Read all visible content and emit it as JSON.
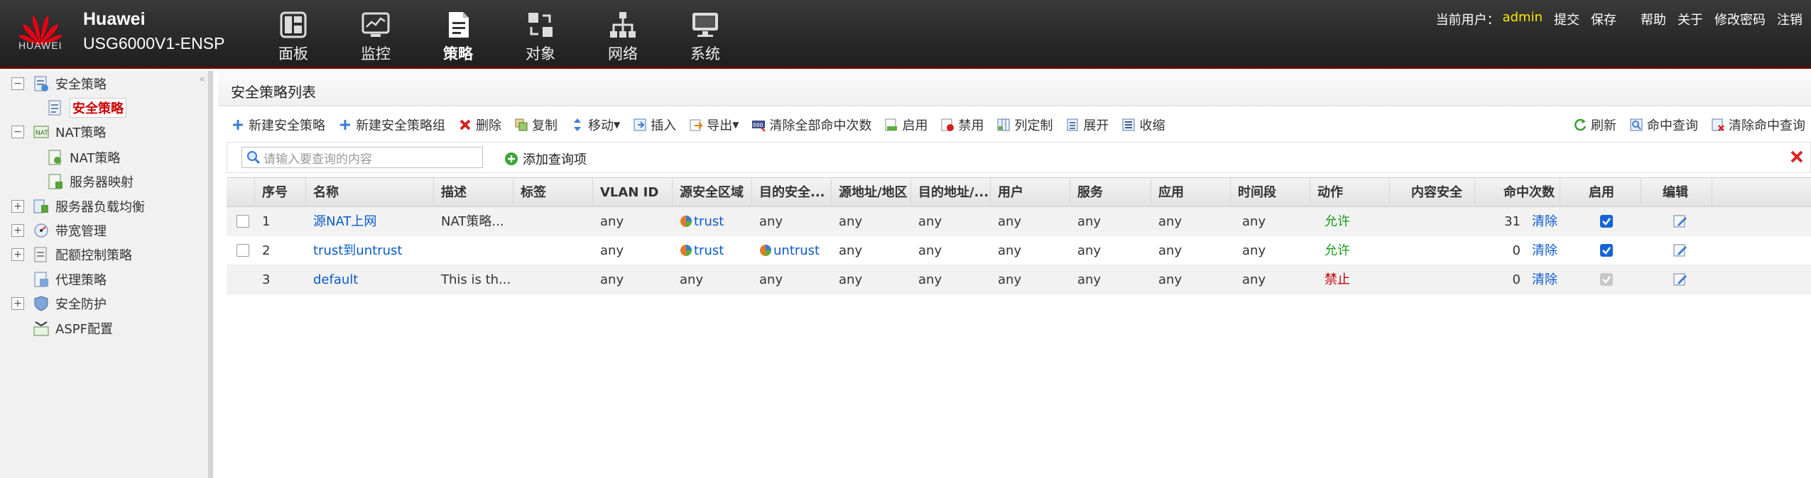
{
  "header": {
    "logo_text": "HUAWEI",
    "brand_line1": "Huawei",
    "brand_line2": "USG6000V1-ENSP",
    "nav": [
      {
        "label": "面板",
        "icon": "dashboard-icon"
      },
      {
        "label": "监控",
        "icon": "monitor-icon"
      },
      {
        "label": "策略",
        "icon": "policy-icon",
        "active": true
      },
      {
        "label": "对象",
        "icon": "object-icon"
      },
      {
        "label": "网络",
        "icon": "network-icon"
      },
      {
        "label": "系统",
        "icon": "system-icon"
      }
    ],
    "current_user_label": "当前用户：",
    "current_user": "admin",
    "actions": [
      "提交",
      "保存",
      "帮助",
      "关于",
      "修改密码",
      "注销"
    ]
  },
  "sidebar": {
    "collapse_glyph": "«",
    "items": [
      {
        "label": "安全策略",
        "level": 0,
        "expander": "−"
      },
      {
        "label": "安全策略",
        "level": 1,
        "selected": true
      },
      {
        "label": "NAT策略",
        "level": 0,
        "expander": "−"
      },
      {
        "label": "NAT策略",
        "level": 1
      },
      {
        "label": "服务器映射",
        "level": 1
      },
      {
        "label": "服务器负载均衡",
        "level": 0,
        "expander": "+"
      },
      {
        "label": "带宽管理",
        "level": 0,
        "expander": "+"
      },
      {
        "label": "配额控制策略",
        "level": 0,
        "expander": "+"
      },
      {
        "label": "代理策略",
        "level": 0
      },
      {
        "label": "安全防护",
        "level": 0,
        "expander": "+"
      },
      {
        "label": "ASPF配置",
        "level": 0
      }
    ]
  },
  "main": {
    "title": "安全策略列表",
    "toolbar": [
      "新建安全策略",
      "新建安全策略组",
      "删除",
      "复制",
      "移动",
      "插入",
      "导出",
      "清除全部命中次数",
      "启用",
      "禁用",
      "列定制",
      "展开",
      "收缩"
    ],
    "toolbar_right": [
      "刷新",
      "命中查询",
      "清除命中查询"
    ],
    "search_placeholder": "请输入要查询的内容",
    "add_query": "添加查询项",
    "columns": [
      "序号",
      "名称",
      "描述",
      "标签",
      "VLAN ID",
      "源安全区域",
      "目的安全...",
      "源地址/地区",
      "目的地址/...",
      "用户",
      "服务",
      "应用",
      "时间段",
      "动作",
      "内容安全",
      "命中次数",
      "启用",
      "编辑"
    ],
    "rows": [
      {
        "no": "1",
        "name": "源NAT上网",
        "desc": "NAT策略...",
        "tag": "",
        "vlan": "any",
        "src_zone": "trust",
        "dst_zone": "any",
        "src_addr": "any",
        "dst_addr": "any",
        "user": "any",
        "service": "any",
        "app": "any",
        "time": "any",
        "action": "允许",
        "action_type": "allow",
        "content": "",
        "hits": "31",
        "clear": "清除",
        "enabled": true
      },
      {
        "no": "2",
        "name": "trust到untrust",
        "desc": "",
        "tag": "",
        "vlan": "any",
        "src_zone": "trust",
        "dst_zone": "untrust",
        "src_addr": "any",
        "dst_addr": "any",
        "user": "any",
        "service": "any",
        "app": "any",
        "time": "any",
        "action": "允许",
        "action_type": "allow",
        "content": "",
        "hits": "0",
        "clear": "清除",
        "enabled": true
      },
      {
        "no": "3",
        "name": "default",
        "desc": "This is th...",
        "tag": "",
        "vlan": "any",
        "src_zone": "any",
        "dst_zone": "any",
        "src_addr": "any",
        "dst_addr": "any",
        "user": "any",
        "service": "any",
        "app": "any",
        "time": "any",
        "action": "禁止",
        "action_type": "deny",
        "content": "",
        "hits": "0",
        "clear": "清除",
        "enabled": true,
        "locked": true
      }
    ]
  }
}
